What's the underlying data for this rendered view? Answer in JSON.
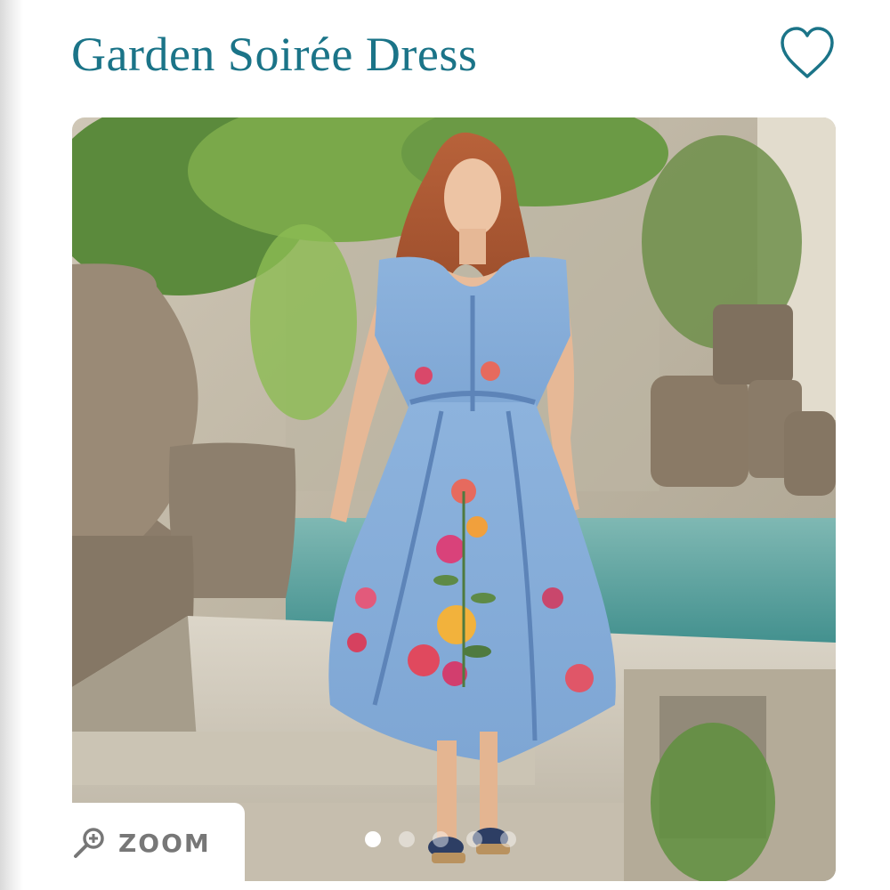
{
  "product": {
    "title": "Garden Soirée Dress"
  },
  "favorite": {
    "icon": "heart-outline-icon",
    "color": "#1b7488"
  },
  "gallery": {
    "zoom_label": "ZOOM",
    "zoom_icon": "magnifier-icon",
    "slides_total": 5,
    "active_slide": 1
  },
  "colors": {
    "brand": "#1b7488",
    "dress": "#86aed8"
  }
}
